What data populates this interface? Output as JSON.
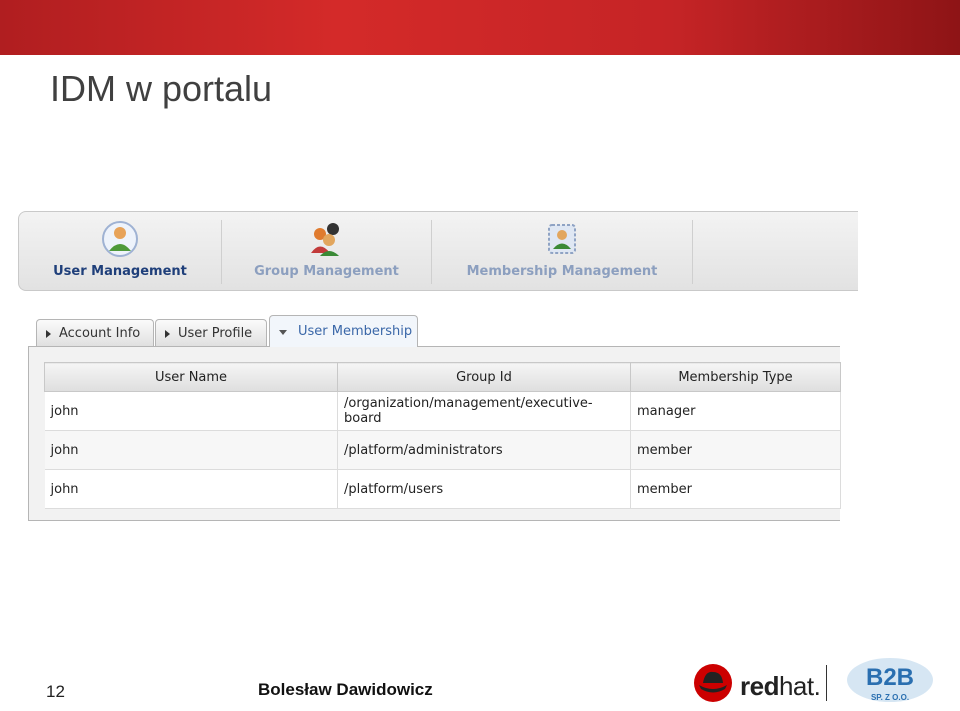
{
  "slide": {
    "title": "IDM w portalu",
    "page_number": "12",
    "author": "Bolesław Dawidowicz"
  },
  "nav": {
    "items": [
      {
        "label": "User Management",
        "icon": "user-icon",
        "color": "#1f3f7a"
      },
      {
        "label": "Group Management",
        "icon": "group-icon",
        "color": "#8c9fbf"
      },
      {
        "label": "Membership Management",
        "icon": "membership-icon",
        "color": "#8c9fbf"
      }
    ]
  },
  "tabs": [
    {
      "label": "Account Info",
      "active": false
    },
    {
      "label": "User Profile",
      "active": false
    },
    {
      "label": "User Membership",
      "active": true
    }
  ],
  "table": {
    "columns": [
      "User Name",
      "Group Id",
      "Membership Type"
    ],
    "rows": [
      [
        "john",
        "/organization/management/executive-board",
        "manager"
      ],
      [
        "john",
        "/platform/administrators",
        "member"
      ],
      [
        "john",
        "/platform/users",
        "member"
      ]
    ]
  },
  "logos": {
    "redhat_text_bold": "red",
    "redhat_text_rest": "hat.",
    "b2b_text": "B2B",
    "b2b_sub": "SP. Z O.O."
  },
  "colors": {
    "header_red": "#c52426",
    "active_nav": "#1f3f7a",
    "inactive_nav": "#8c9fbf",
    "active_tab": "#3a67a8"
  }
}
